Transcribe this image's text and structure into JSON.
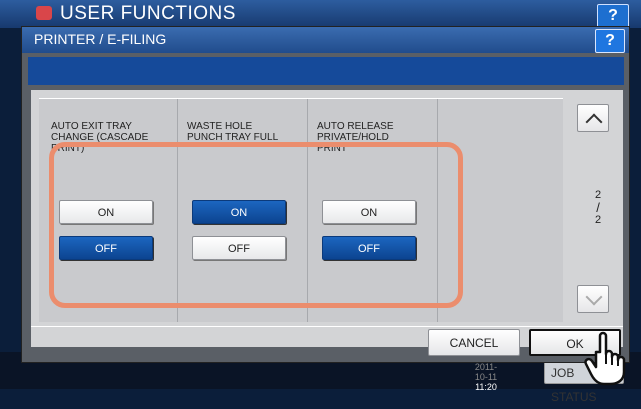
{
  "background": {
    "title": "USER FUNCTIONS",
    "help_label": "?",
    "clock_date": "2011-10-11",
    "clock_time": "11:20",
    "job_status_label": "JOB STATUS"
  },
  "dialog": {
    "title": "PRINTER / E-FILING",
    "help_label": "?",
    "settings": [
      {
        "label": "AUTO EXIT TRAY CHANGE (CASCADE PRINT)",
        "on_label": "ON",
        "off_label": "OFF",
        "value": "OFF"
      },
      {
        "label": "WASTE HOLE PUNCH TRAY FULL",
        "on_label": "ON",
        "off_label": "OFF",
        "value": "ON"
      },
      {
        "label": "AUTO RELEASE PRIVATE/HOLD PRINT",
        "on_label": "ON",
        "off_label": "OFF",
        "value": "OFF"
      }
    ],
    "page": {
      "current": "2",
      "total": "2"
    },
    "cancel_label": "CANCEL",
    "ok_label": "OK"
  },
  "colors": {
    "accent": "#1c66c0",
    "highlight": "#eb8d6d",
    "title_bar": "#2d5d9f"
  },
  "icons": {
    "scroll_up": "chevron-up-icon",
    "scroll_down": "chevron-down-icon",
    "pointer": "hand-pointer-icon",
    "logo": "printer-logo-icon"
  }
}
